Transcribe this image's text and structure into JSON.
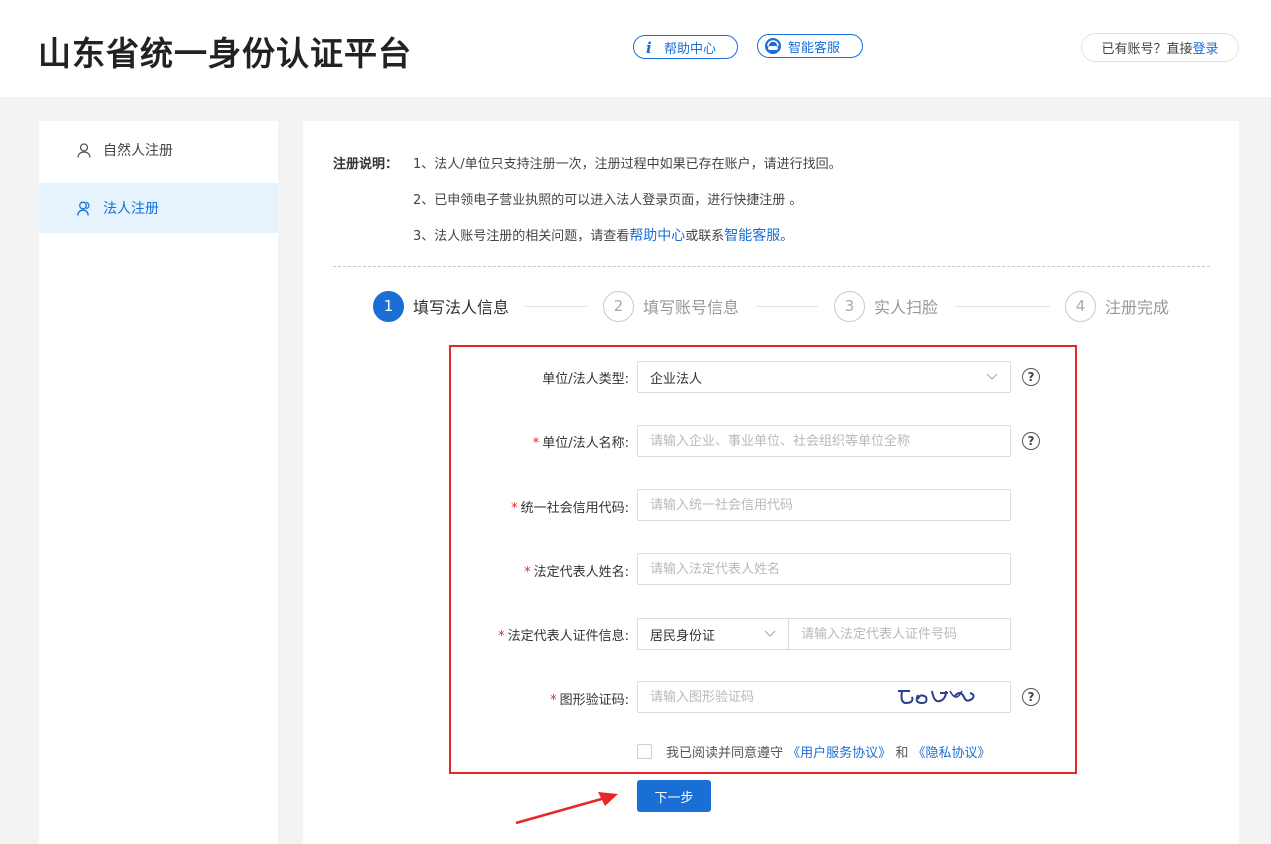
{
  "header": {
    "title": "山东省统一身份认证平台",
    "help_label": "帮助中心",
    "service_label": "智能客服",
    "login_prefix": "已有账号？直接",
    "login_link": "登录"
  },
  "sidebar": {
    "items": [
      {
        "label": "自然人注册",
        "icon": "person-icon",
        "active": false
      },
      {
        "label": "法人注册",
        "icon": "people-icon",
        "active": true
      }
    ]
  },
  "notes": {
    "label": "注册说明：",
    "line1": "1、法人/单位只支持注册一次，注册过程中如果已存在账户，请进行找回。",
    "line2": "2、已申领电子营业执照的可以进入法人登录页面，进行快捷注册 。",
    "line3_prefix": "3、法人账号注册的相关问题，请查看",
    "line3_help": "帮助中心",
    "line3_mid": "或联系",
    "line3_service": "智能客服",
    "line3_suffix": "。"
  },
  "steps": [
    {
      "num": "1",
      "label": "填写法人信息",
      "active": true
    },
    {
      "num": "2",
      "label": "填写账号信息",
      "active": false
    },
    {
      "num": "3",
      "label": "实人扫脸",
      "active": false
    },
    {
      "num": "4",
      "label": "注册完成",
      "active": false
    }
  ],
  "form": {
    "type_label": "单位/法人类型:",
    "type_value": "企业法人",
    "name_label": "单位/法人名称:",
    "name_placeholder": "请输入企业、事业单位、社会组织等单位全称",
    "credit_label": "统一社会信用代码:",
    "credit_placeholder": "请输入统一社会信用代码",
    "rep_label": "法定代表人姓名:",
    "rep_placeholder": "请输入法定代表人姓名",
    "id_label": "法定代表人证件信息:",
    "id_type": "居民身份证",
    "id_placeholder": "请输入法定代表人证件号码",
    "captcha_label": "图形验证码:",
    "captcha_placeholder": "请输入图形验证码",
    "required_mark": "*",
    "help_mark": "?"
  },
  "agreement": {
    "prefix": "我已阅读并同意遵守",
    "user_agreement": "《用户服务协议》",
    "and": "和",
    "privacy": "《隐私协议》"
  },
  "next_button": "下一步",
  "colors": {
    "accent": "#1a6fd6",
    "highlight_box": "#e8262a",
    "active_sidebar_bg": "#e6f3fd"
  }
}
